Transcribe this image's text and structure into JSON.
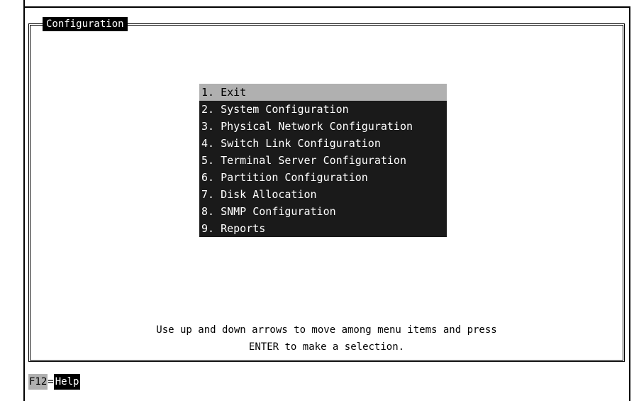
{
  "window": {
    "title": "Configuration"
  },
  "menu": {
    "selected_index": 0,
    "items": [
      {
        "label": "1. Exit"
      },
      {
        "label": "2. System Configuration"
      },
      {
        "label": "3. Physical Network Configuration"
      },
      {
        "label": "4. Switch Link Configuration"
      },
      {
        "label": "5. Terminal Server Configuration"
      },
      {
        "label": "6. Partition Configuration"
      },
      {
        "label": "7. Disk Allocation"
      },
      {
        "label": "8. SNMP Configuration"
      },
      {
        "label": "9. Reports"
      }
    ]
  },
  "hint": {
    "line1": "Use up and down arrows to move among menu items and press",
    "line2": "ENTER to make a selection."
  },
  "statusbar": {
    "key": "F12",
    "separator": "=",
    "action": "Help"
  },
  "colors": {
    "menu_background": "#1a1a1a",
    "selection_background": "#b0b0b0",
    "title_background": "#000000"
  }
}
